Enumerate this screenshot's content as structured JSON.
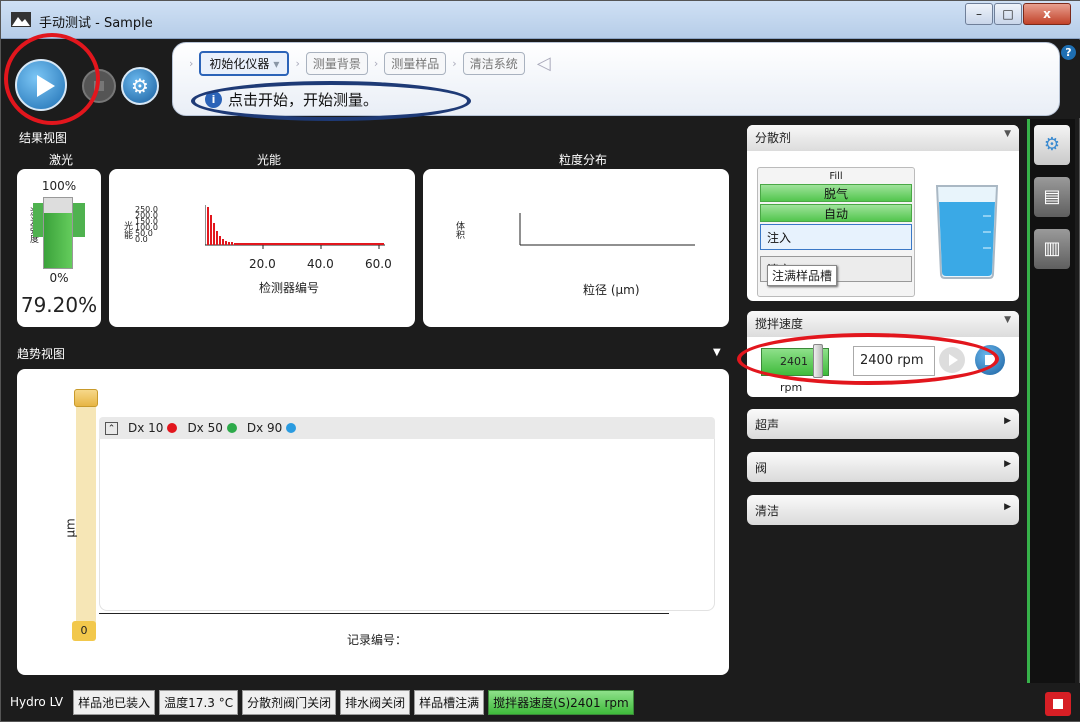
{
  "window": {
    "title": "手动测试 - Sample",
    "close_label": "x"
  },
  "toolbar": {
    "steps": [
      "初始化仪器",
      "测量背景",
      "测量样品",
      "清洁系统"
    ],
    "message": "点击开始，开始测量。",
    "info_icon": "i",
    "help_icon": "?"
  },
  "results": {
    "title": "结果视图",
    "laser": {
      "title": "激光",
      "max": "100%",
      "min": "0%",
      "value": "79.20%",
      "level": 0.792,
      "ylabel": "激光强度"
    },
    "light": {
      "title": "光能",
      "ylabel": "光能",
      "ticks_y": [
        "250.0",
        "200.0",
        "150.0",
        "100.0",
        "50.0",
        "0.0"
      ],
      "ticks_x": [
        "20.0",
        "40.0",
        "60.0"
      ],
      "xlabel": "检测器编号"
    },
    "psd": {
      "title": "粒度分布",
      "ylabel": "体积",
      "xlabel": "粒径 (μm)"
    }
  },
  "trend": {
    "title": "趋势视图",
    "legend": [
      "Dx 10",
      "Dx 50",
      "Dx 90"
    ],
    "legend_colors": [
      "#e2161d",
      "#2daa4a",
      "#2a9be0"
    ],
    "ylabel": "μm",
    "xlabel": "记录编号：",
    "slider_min": "0"
  },
  "dispersant": {
    "title": "分散剂",
    "fill_title": "Fill",
    "items": [
      "脱气",
      "自动",
      "注入",
      "清空"
    ],
    "tooltip": "注满样品槽"
  },
  "stir": {
    "title": "搅拌速度",
    "current": "2401",
    "unit": "rpm",
    "target": "2400 rpm"
  },
  "collapsed": [
    "超声",
    "阀",
    "清洁"
  ],
  "statusbar": {
    "name": "Hydro LV",
    "chips": [
      "样品池已装入",
      "温度17.3 °C",
      "分散剂阀门关闭",
      "排水阀关闭",
      "样品槽注满",
      "搅拌器速度(S)2401 rpm"
    ]
  }
}
